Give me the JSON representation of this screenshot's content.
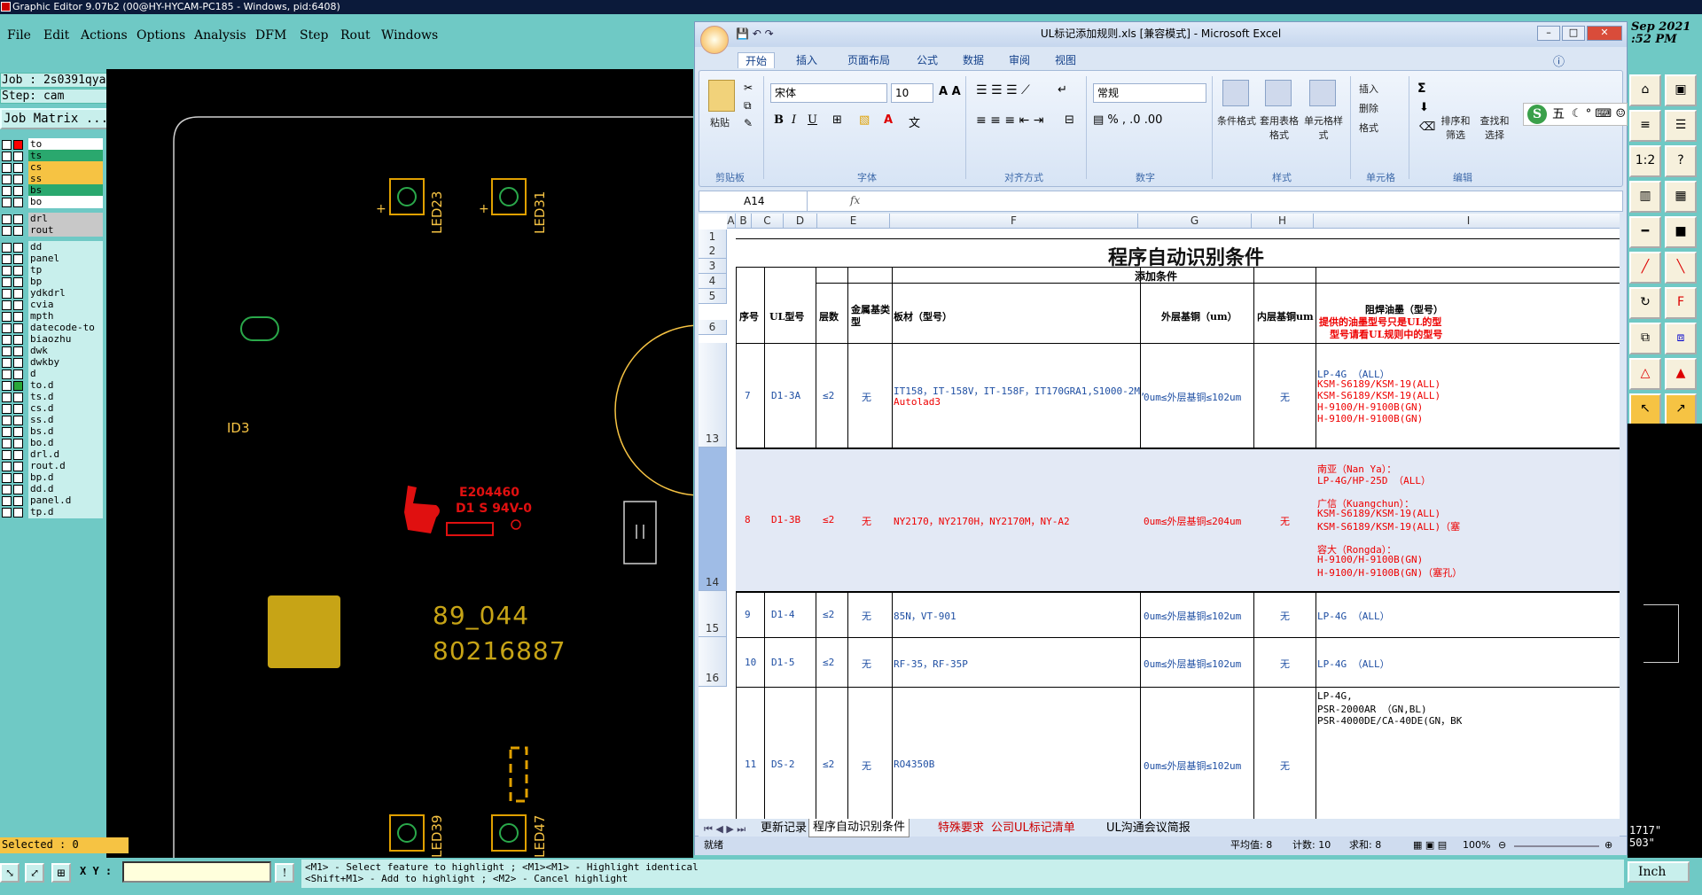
{
  "ge": {
    "title": "Graphic Editor 9.07b2 (00@HY-HYCAM-PC185 - Windows, pid:6408)",
    "menu": [
      "File",
      "Edit",
      "Actions",
      "Options",
      "Analysis",
      "DFM",
      "Step",
      "Rout",
      "Windows"
    ],
    "job": "Job : 2s0391qya0",
    "step": "Step: cam",
    "job_matrix": "Job Matrix ...",
    "layers": [
      {
        "name": "to",
        "color": "#ffffff",
        "swatch": "#ff0000"
      },
      {
        "name": "ts",
        "color": "#2aa86e",
        "swatch": ""
      },
      {
        "name": "cs",
        "color": "#f6c343",
        "swatch": ""
      },
      {
        "name": "ss",
        "color": "#f6c343",
        "swatch": ""
      },
      {
        "name": "bs",
        "color": "#2aa86e",
        "swatch": ""
      },
      {
        "name": "bo",
        "color": "#ffffff",
        "swatch": ""
      },
      {
        "name": "drl",
        "color": "#c8c8c8",
        "swatch": ""
      },
      {
        "name": "rout",
        "color": "#c8c8c8",
        "swatch": ""
      },
      {
        "name": "dd",
        "color": "#c8efec",
        "swatch": ""
      },
      {
        "name": "panel",
        "color": "#c8efec",
        "swatch": ""
      },
      {
        "name": "tp",
        "color": "#c8efec",
        "swatch": ""
      },
      {
        "name": "bp",
        "color": "#c8efec",
        "swatch": ""
      },
      {
        "name": "ydkdrl",
        "color": "#c8efec",
        "swatch": ""
      },
      {
        "name": "cvia",
        "color": "#c8efec",
        "swatch": ""
      },
      {
        "name": "mpth",
        "color": "#c8efec",
        "swatch": ""
      },
      {
        "name": "datecode-to",
        "color": "#c8efec",
        "swatch": ""
      },
      {
        "name": "biaozhu",
        "color": "#c8efec",
        "swatch": ""
      },
      {
        "name": "dwk",
        "color": "#c8efec",
        "swatch": ""
      },
      {
        "name": "dwkby",
        "color": "#c8efec",
        "swatch": ""
      },
      {
        "name": "d",
        "color": "#c8efec",
        "swatch": ""
      },
      {
        "name": "to.d",
        "color": "#c8efec",
        "swatch": "#2aa83a"
      },
      {
        "name": "ts.d",
        "color": "#c8efec",
        "swatch": ""
      },
      {
        "name": "cs.d",
        "color": "#c8efec",
        "swatch": ""
      },
      {
        "name": "ss.d",
        "color": "#c8efec",
        "swatch": ""
      },
      {
        "name": "bs.d",
        "color": "#c8efec",
        "swatch": ""
      },
      {
        "name": "bo.d",
        "color": "#c8efec",
        "swatch": ""
      },
      {
        "name": "drl.d",
        "color": "#c8efec",
        "swatch": ""
      },
      {
        "name": "rout.d",
        "color": "#c8efec",
        "swatch": ""
      },
      {
        "name": "bp.d",
        "color": "#c8efec",
        "swatch": ""
      },
      {
        "name": "dd.d",
        "color": "#c8efec",
        "swatch": ""
      },
      {
        "name": "panel.d",
        "color": "#c8efec",
        "swatch": ""
      },
      {
        "name": "tp.d",
        "color": "#c8efec",
        "swatch": ""
      }
    ],
    "canvas": {
      "led1": "LED23",
      "led2": "LED31",
      "led3": "LED39",
      "led4": "LED47",
      "id3": "ID3",
      "ul_code": "E204460",
      "ul_rating": "D1 S 94V-0",
      "text1": "89_044",
      "text2": "80216887"
    },
    "selected": "Selected : 0",
    "xy_label": "X Y :",
    "hint_line1": "<M1> - Select feature to highlight ; <M1><M1> - Highlight identical",
    "hint_line2": "<Shift+M1> - Add to highlight ; <M2> - Cancel highlight",
    "clock_line1": "Sep 2021",
    "clock_line2": ":52 PM",
    "right_coords1": "1717\"",
    "right_coords2": "503\"",
    "unit": "Inch"
  },
  "excel": {
    "title": "UL标记添加规则.xls  [兼容模式] - Microsoft Excel",
    "tabs": [
      "开始",
      "插入",
      "页面布局",
      "公式",
      "数据",
      "审阅",
      "视图"
    ],
    "font_name": "宋体",
    "font_size": "10",
    "number_format": "常规",
    "groups": [
      "剪贴板",
      "字体",
      "对齐方式",
      "数字",
      "样式",
      "单元格",
      "编辑"
    ],
    "buttons": {
      "paste": "粘贴",
      "cond_format": "条件格式",
      "table_format": "套用表格格式",
      "cell_style": "单元格样式",
      "insert": "插入",
      "delete": "删除",
      "format": "格式",
      "sort": "排序和筛选",
      "find": "查找和选择"
    },
    "name_box": "A14",
    "fx": "fx",
    "columns": [
      "A",
      "B",
      "C",
      "D",
      "E",
      "F",
      "G",
      "H",
      "I"
    ],
    "sheet_title": "程序自动识别条件",
    "add_condition": "添加条件",
    "headers": {
      "seq": "序号",
      "ul": "UL型号",
      "layers": "层数",
      "metal": "金属基类型",
      "board": "板材（型号）",
      "outer": "外层基铜（um）",
      "inner": "内层基铜um",
      "mask": "阻焊油墨（型号）",
      "mask_note1": "提供的油墨型号只是UL的型",
      "mask_note2": "型号请看UL规则中的型号"
    },
    "rows": [
      {
        "rownum": "13",
        "seq": "7",
        "ul": "D1-3A",
        "layers": "≤2",
        "metal": "无",
        "board": [
          "IT158，IT-158V，IT-158F，IT170GRA1,S1000-2M,",
          "Autolad3"
        ],
        "outer": "0um≤外层基铜≤102um",
        "inner": "无",
        "mask": [
          "LP-4G （ALL）",
          "KSM-S6189/KSM-19(ALL)",
          "KSM-S6189/KSM-19(ALL)",
          "H-9100/H-9100B(GN)",
          "H-9100/H-9100B(GN)"
        ]
      },
      {
        "rownum": "14",
        "seq": "8",
        "ul": "D1-3B",
        "layers": "≤2",
        "metal": "无",
        "board": [
          "NY2170，NY2170H，NY2170M，NY-A2"
        ],
        "outer": "0um≤外层基铜≤204um",
        "inner": "无",
        "mask": [
          "南亚（Nan Ya）：",
          "LP-4G/HP-25D （ALL）",
          "",
          "广信（Kuangchun）：",
          "KSM-S6189/KSM-19(ALL)",
          "KSM-S6189/KSM-19(ALL)（塞",
          "",
          "容大（Rongda）：",
          "H-9100/H-9100B(GN)",
          "H-9100/H-9100B(GN)（塞孔）"
        ]
      },
      {
        "rownum": "15",
        "seq": "9",
        "ul": "D1-4",
        "layers": "≤2",
        "metal": "无",
        "board": [
          "85N，VT-901"
        ],
        "outer": "0um≤外层基铜≤102um",
        "inner": "无",
        "mask": [
          "LP-4G （ALL）"
        ]
      },
      {
        "rownum": "16",
        "seq": "10",
        "ul": "D1-5",
        "layers": "≤2",
        "metal": "无",
        "board": [
          "RF-35，RF-35P"
        ],
        "outer": "0um≤外层基铜≤102um",
        "inner": "无",
        "mask": [
          "LP-4G （ALL）"
        ]
      },
      {
        "rownum": "",
        "seq": "11",
        "ul": "DS-2",
        "layers": "≤2",
        "metal": "无",
        "board": [
          "RO4350B"
        ],
        "outer": "0um≤外层基铜≤102um",
        "inner": "无",
        "mask": [
          "LP-4G,",
          "PSR-2000AR （GN,BL)",
          "PSR-4000DE/CA-40DE(GN，BK"
        ]
      }
    ],
    "sheet_tabs": [
      "更新记录",
      "程序自动识别条件",
      "特殊要求",
      "公司UL标记清单",
      "UL沟通会议简报"
    ],
    "status_ready": "就绪",
    "status_avg": "平均值: 8",
    "status_count": "计数: 10",
    "status_sum": "求和: 8",
    "zoom": "100%"
  },
  "ime": {
    "logo": "S",
    "mode": "五"
  }
}
